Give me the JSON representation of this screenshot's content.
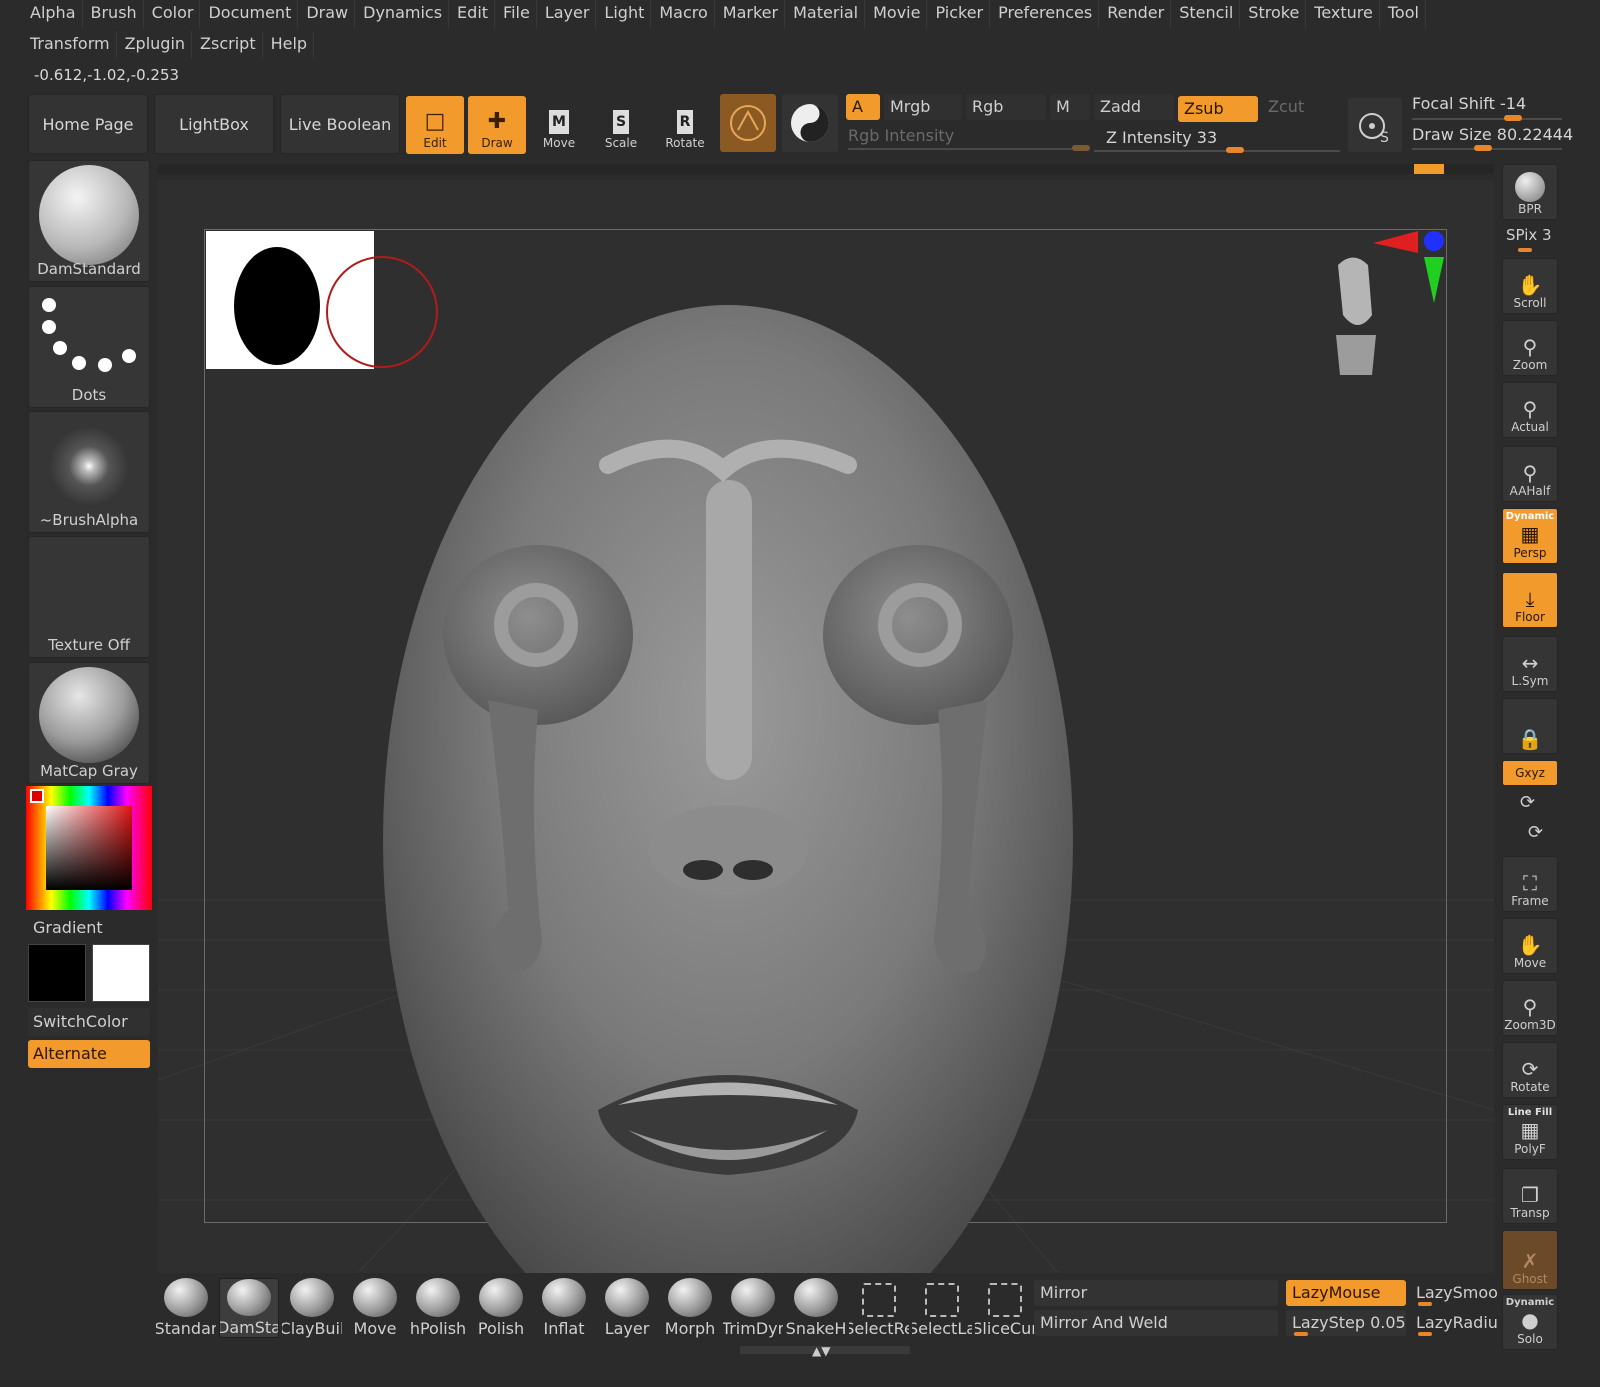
{
  "menu_row1": [
    "Alpha",
    "Brush",
    "Color",
    "Document",
    "Draw",
    "Dynamics",
    "Edit",
    "File",
    "Layer",
    "Light",
    "Macro",
    "Marker",
    "Material",
    "Movie",
    "Picker",
    "Preferences",
    "Render",
    "Stencil",
    "Stroke",
    "Texture",
    "Tool"
  ],
  "menu_row2": [
    "Transform",
    "Zplugin",
    "Zscript",
    "Help"
  ],
  "coords": "-0.612,-1.02,-0.253",
  "shelf": {
    "home_page": "Home Page",
    "lightbox": "LightBox",
    "live_boolean": "Live Boolean",
    "edit": "Edit",
    "draw": "Draw",
    "move": "Move",
    "scale": "Scale",
    "rotate": "Rotate",
    "a": "A",
    "mrgb": "Mrgb",
    "rgb": "Rgb",
    "m": "M",
    "rgb_intensity": "Rgb Intensity",
    "zadd": "Zadd",
    "zsub": "Zsub",
    "zcut": "Zcut",
    "z_intensity": "Z Intensity 33",
    "focal_shift": "Focal Shift -14",
    "draw_size": "Draw Size 80.22444"
  },
  "left": {
    "brush": "DamStandard",
    "stroke": "Dots",
    "alpha": "~BrushAlpha",
    "texture": "Texture Off",
    "material": "MatCap Gray",
    "gradient": "Gradient",
    "switch_color": "SwitchColor",
    "alternate": "Alternate"
  },
  "right": {
    "bpr": "BPR",
    "spix": "SPix 3",
    "scroll": "Scroll",
    "zoom": "Zoom",
    "actual": "Actual",
    "aahalf": "AAHalf",
    "dynamic": "Dynamic",
    "persp": "Persp",
    "floor": "Floor",
    "lsym": "L.Sym",
    "xyz": "Gxyz",
    "frame": "Frame",
    "move": "Move",
    "zoom3d": "Zoom3D",
    "rotate": "Rotate",
    "line_fill": "Line Fill",
    "polyf": "PolyF",
    "transp": "Transp",
    "ghost": "Ghost",
    "dynamic2": "Dynamic",
    "solo": "Solo"
  },
  "bottom": {
    "brushes": [
      "Standar",
      "DamSta",
      "ClayBuil",
      "Move",
      "hPolish",
      "Polish",
      "Inflat",
      "Layer",
      "Morph",
      "TrimDyr",
      "SnakeH",
      "SelectRe",
      "SelectLa",
      "SliceCur"
    ],
    "mirror": "Mirror",
    "mirror_weld": "Mirror And Weld",
    "lazymouse": "LazyMouse",
    "lazystep": "LazyStep 0.05",
    "lazysmooth": "LazySmoot",
    "lazyradius": "LazyRadius"
  },
  "colors": {
    "accent": "#f39a2c",
    "panel": "#333333",
    "background": "#2b2b2b"
  }
}
